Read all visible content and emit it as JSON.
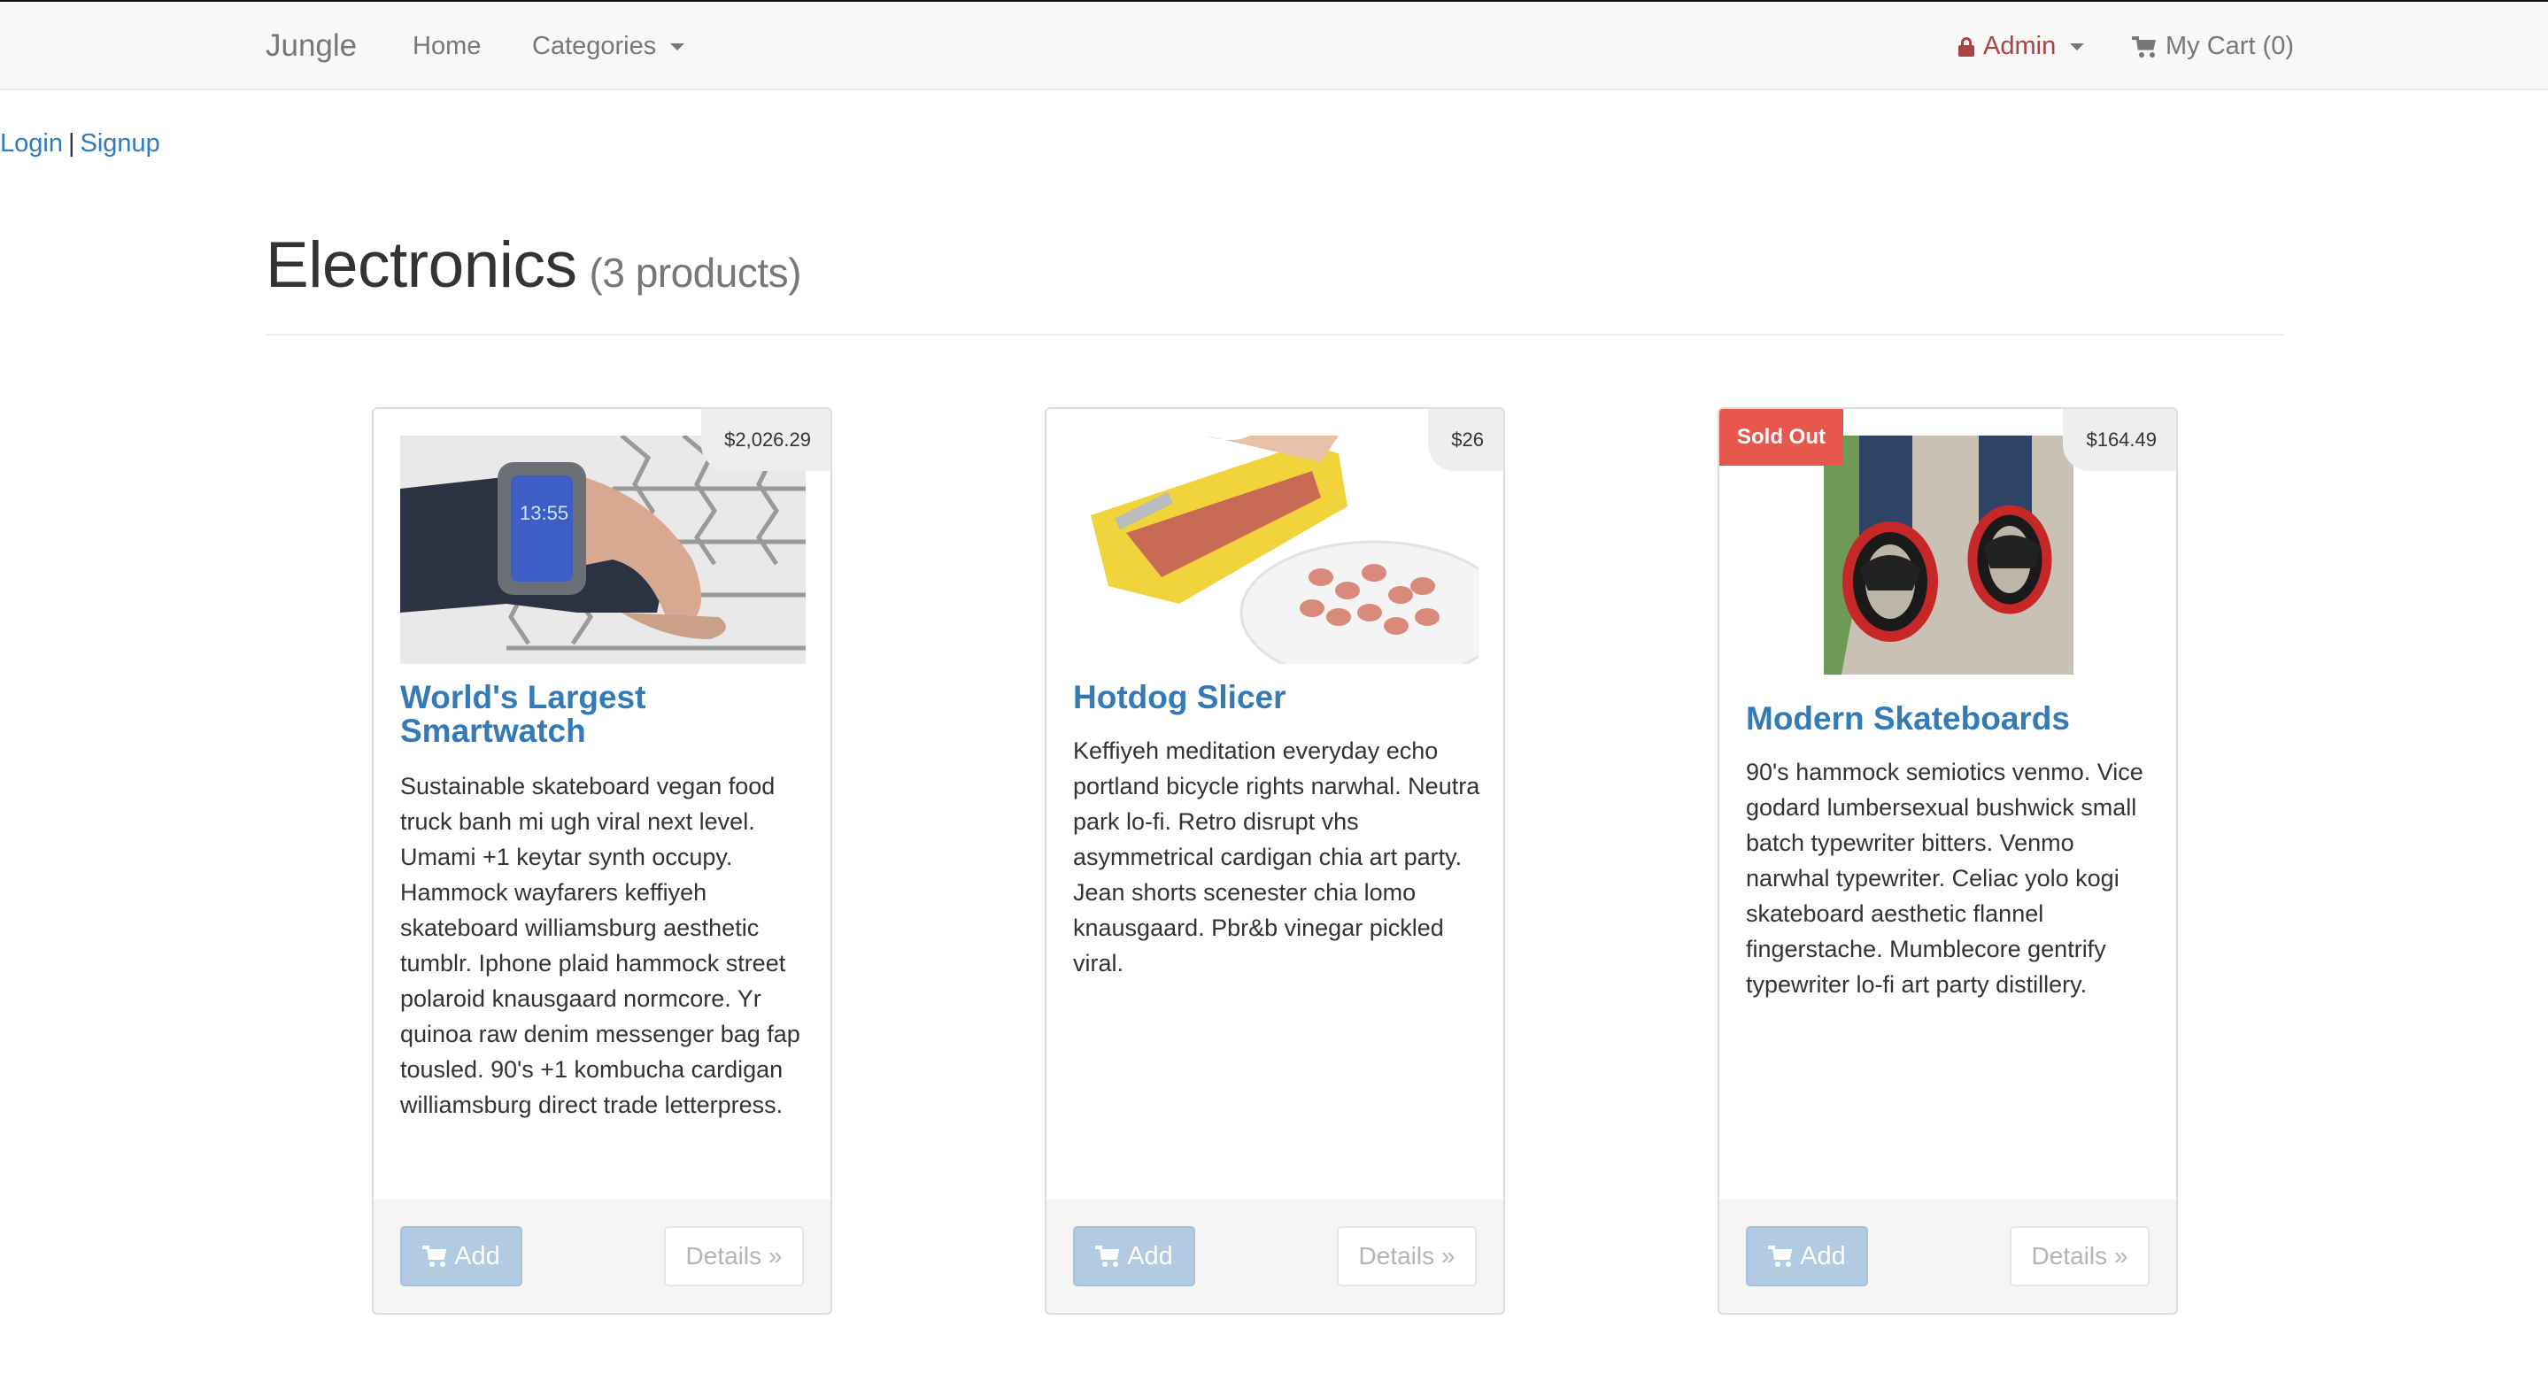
{
  "nav": {
    "brand": "Jungle",
    "home": "Home",
    "categories": "Categories",
    "admin": "Admin",
    "cart": "My Cart (0)"
  },
  "auth": {
    "login": "Login",
    "separator": "|",
    "signup": "Signup"
  },
  "page": {
    "title": "Electronics",
    "count": "(3 products)"
  },
  "products": [
    {
      "name": "World's Largest Smartwatch",
      "price": "$2,026.29",
      "description": "Sustainable skateboard vegan food truck banh mi ugh viral next level. Umami +1 keytar synth occupy. Hammock wayfarers keffiyeh skateboard williamsburg aesthetic tumblr. Iphone plaid hammock street polaroid knausgaard normcore. Yr quinoa raw denim messenger bag fap tousled. 90's +1 kombucha cardigan williamsburg direct trade letterpress.",
      "add": "Add",
      "details": "Details »"
    },
    {
      "name": "Hotdog Slicer",
      "price": "$26",
      "description": "Keffiyeh meditation everyday echo portland bicycle rights narwhal. Neutra park lo-fi. Retro disrupt vhs asymmetrical cardigan chia art party. Jean shorts scenester chia lomo knausgaard. Pbr&b vinegar pickled viral.",
      "add": "Add",
      "details": "Details »"
    },
    {
      "name": "Modern Skateboards",
      "price": "$164.49",
      "badge": "Sold Out",
      "description": "90's hammock semiotics venmo. Vice godard lumbersexual bushwick small batch typewriter bitters. Venmo narwhal typewriter. Celiac yolo kogi skateboard aesthetic flannel fingerstache. Mumblecore gentrify typewriter lo-fi art party distillery.",
      "add": "Add",
      "details": "Details »"
    }
  ],
  "colors": {
    "link": "#337ab7",
    "admin": "#a94442",
    "sold_out": "#e8574b",
    "add_button": "#b2cbe2"
  }
}
